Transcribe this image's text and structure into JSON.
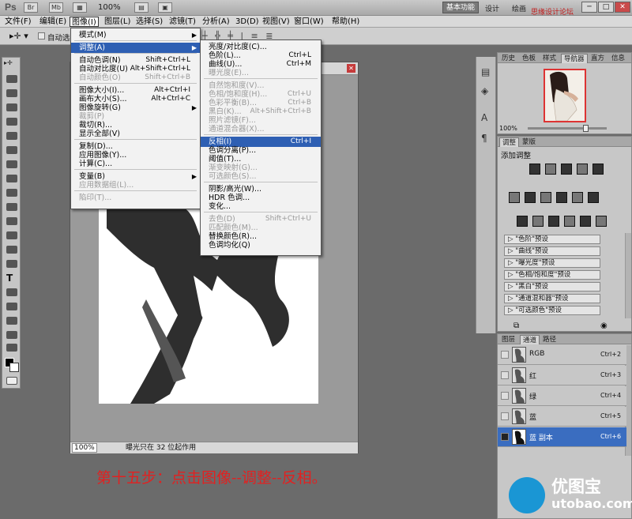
{
  "app": {
    "logo": "Ps",
    "zoom": "100%",
    "workspace": "基本功能",
    "workspace_2": "设计",
    "workspace_3": "绘画",
    "watermark": "思缘设计论坛 www.MISSYUAN.COM"
  },
  "menubar": [
    "文件(F)",
    "编辑(E)",
    "图像(I)",
    "图层(L)",
    "选择(S)",
    "滤镜(T)",
    "分析(A)",
    "3D(D)",
    "视图(V)",
    "窗口(W)",
    "帮助(H)"
  ],
  "options": {
    "auto_select": "自动选择"
  },
  "image_menu": [
    {
      "label": "模式(M)",
      "arrow": true
    },
    {
      "sep": true
    },
    {
      "label": "调整(A)",
      "arrow": true,
      "hl": true
    },
    {
      "sep": true
    },
    {
      "label": "自动色调(N)",
      "sc": "Shift+Ctrl+L"
    },
    {
      "label": "自动对比度(U)",
      "sc": "Alt+Shift+Ctrl+L"
    },
    {
      "label": "自动颜色(O)",
      "sc": "Shift+Ctrl+B",
      "dis": true
    },
    {
      "sep": true
    },
    {
      "label": "图像大小(I)...",
      "sc": "Alt+Ctrl+I"
    },
    {
      "label": "画布大小(S)...",
      "sc": "Alt+Ctrl+C"
    },
    {
      "label": "图像旋转(G)",
      "arrow": true
    },
    {
      "label": "裁剪(P)",
      "dis": true
    },
    {
      "label": "裁切(R)..."
    },
    {
      "label": "显示全部(V)"
    },
    {
      "sep": true
    },
    {
      "label": "复制(D)..."
    },
    {
      "label": "应用图像(Y)..."
    },
    {
      "label": "计算(C)..."
    },
    {
      "sep": true
    },
    {
      "label": "变量(B)",
      "arrow": true
    },
    {
      "label": "应用数据组(L)...",
      "dis": true
    },
    {
      "sep": true
    },
    {
      "label": "陷印(T)...",
      "dis": true
    }
  ],
  "adjust_menu": [
    {
      "label": "亮度/对比度(C)..."
    },
    {
      "label": "色阶(L)...",
      "sc": "Ctrl+L"
    },
    {
      "label": "曲线(U)...",
      "sc": "Ctrl+M"
    },
    {
      "label": "曝光度(E)...",
      "dis": true
    },
    {
      "sep": true
    },
    {
      "label": "自然饱和度(V)...",
      "dis": true
    },
    {
      "label": "色相/饱和度(H)...",
      "sc": "Ctrl+U",
      "dis": true
    },
    {
      "label": "色彩平衡(B)...",
      "sc": "Ctrl+B",
      "dis": true
    },
    {
      "label": "黑白(K)...",
      "sc": "Alt+Shift+Ctrl+B",
      "dis": true
    },
    {
      "label": "照片滤镜(F)...",
      "dis": true
    },
    {
      "label": "通道混合器(X)...",
      "dis": true
    },
    {
      "sep": true
    },
    {
      "label": "反相(I)",
      "sc": "Ctrl+I",
      "hl": true
    },
    {
      "label": "色调分离(P)..."
    },
    {
      "label": "阈值(T)..."
    },
    {
      "label": "渐变映射(G)...",
      "dis": true
    },
    {
      "label": "可选颜色(S)...",
      "dis": true
    },
    {
      "sep": true
    },
    {
      "label": "阴影/高光(W)..."
    },
    {
      "label": "HDR 色调..."
    },
    {
      "label": "变化..."
    },
    {
      "sep": true
    },
    {
      "label": "去色(D)",
      "sc": "Shift+Ctrl+U",
      "dis": true
    },
    {
      "label": "匹配颜色(M)...",
      "dis": true
    },
    {
      "label": "替换颜色(R)..."
    },
    {
      "label": "色调均化(Q)"
    }
  ],
  "doc": {
    "zoom": "100%",
    "status": "曝光只在 32 位起作用"
  },
  "nav_panel": {
    "tabs": [
      "历史",
      "色板",
      "样式",
      "导航器",
      "直方",
      "信息"
    ],
    "active": 3,
    "zoom": "100%"
  },
  "adj_panel": {
    "tabs": [
      "调整",
      "蒙版"
    ],
    "title": "添加调整",
    "presets": [
      "\"色阶\"预设",
      "\"曲线\"预设",
      "\"曝光度\"预设",
      "\"色相/饱和度\"预设",
      "\"黑白\"预设",
      "\"通道混和器\"预设",
      "\"可选颜色\"预设"
    ]
  },
  "ch_panel": {
    "tabs": [
      "图层",
      "通道",
      "路径"
    ],
    "active": 1,
    "channels": [
      {
        "name": "RGB",
        "key": "Ctrl+2"
      },
      {
        "name": "红",
        "key": "Ctrl+3"
      },
      {
        "name": "绿",
        "key": "Ctrl+4"
      },
      {
        "name": "蓝",
        "key": "Ctrl+5"
      },
      {
        "name": "蓝 副本",
        "key": "Ctrl+6",
        "sel": true
      }
    ]
  },
  "caption": "第十五步：点击图像--调整--反相。",
  "brand": {
    "cn": "优图宝",
    "en": "utobao.com"
  }
}
